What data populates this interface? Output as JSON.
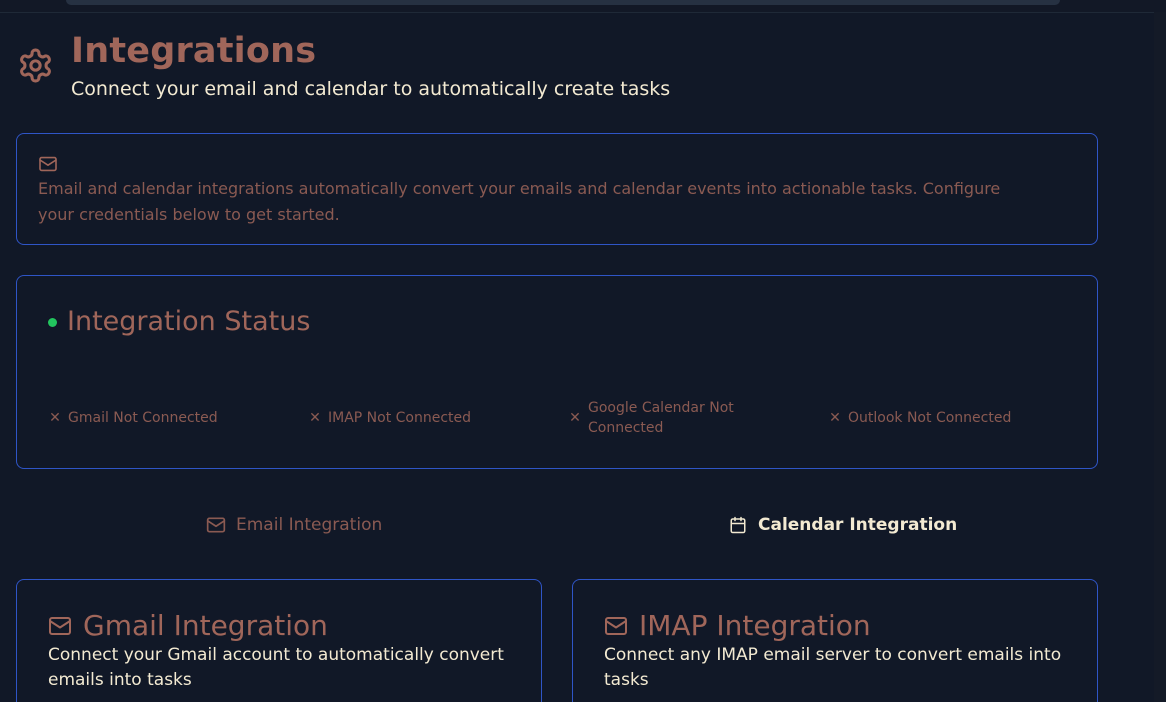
{
  "header": {
    "title": "Integrations",
    "subtitle": "Connect your email and calendar to automatically create tasks",
    "icon": "gear-icon"
  },
  "info_card": {
    "icon": "mail-icon",
    "text": "Email and calendar integrations automatically convert your emails and calendar events into actionable tasks. Configure your credentials below to get started."
  },
  "status": {
    "title": "Integration Status",
    "indicator_color": "#22c55e",
    "items": [
      {
        "icon": "x-icon",
        "label": "Gmail Not Connected"
      },
      {
        "icon": "x-icon",
        "label": "IMAP Not Connected"
      },
      {
        "icon": "x-icon",
        "label": "Google Calendar Not Connected"
      },
      {
        "icon": "x-icon",
        "label": "Outlook Not Connected"
      }
    ]
  },
  "tabs": [
    {
      "icon": "mail-icon",
      "label": "Email Integration",
      "active": false
    },
    {
      "icon": "calendar-icon",
      "label": "Calendar Integration",
      "active": true
    }
  ],
  "integrations": [
    {
      "icon": "mail-icon",
      "title": "Gmail Integration",
      "description": "Connect your Gmail account to automatically convert emails into tasks"
    },
    {
      "icon": "mail-icon",
      "title": "IMAP Integration",
      "description": "Connect any IMAP email server to convert emails into tasks"
    }
  ],
  "colors": {
    "background": "#111827",
    "card_border": "#2f55c7",
    "accent": "#a0665a",
    "text_light": "#f3ead2"
  }
}
